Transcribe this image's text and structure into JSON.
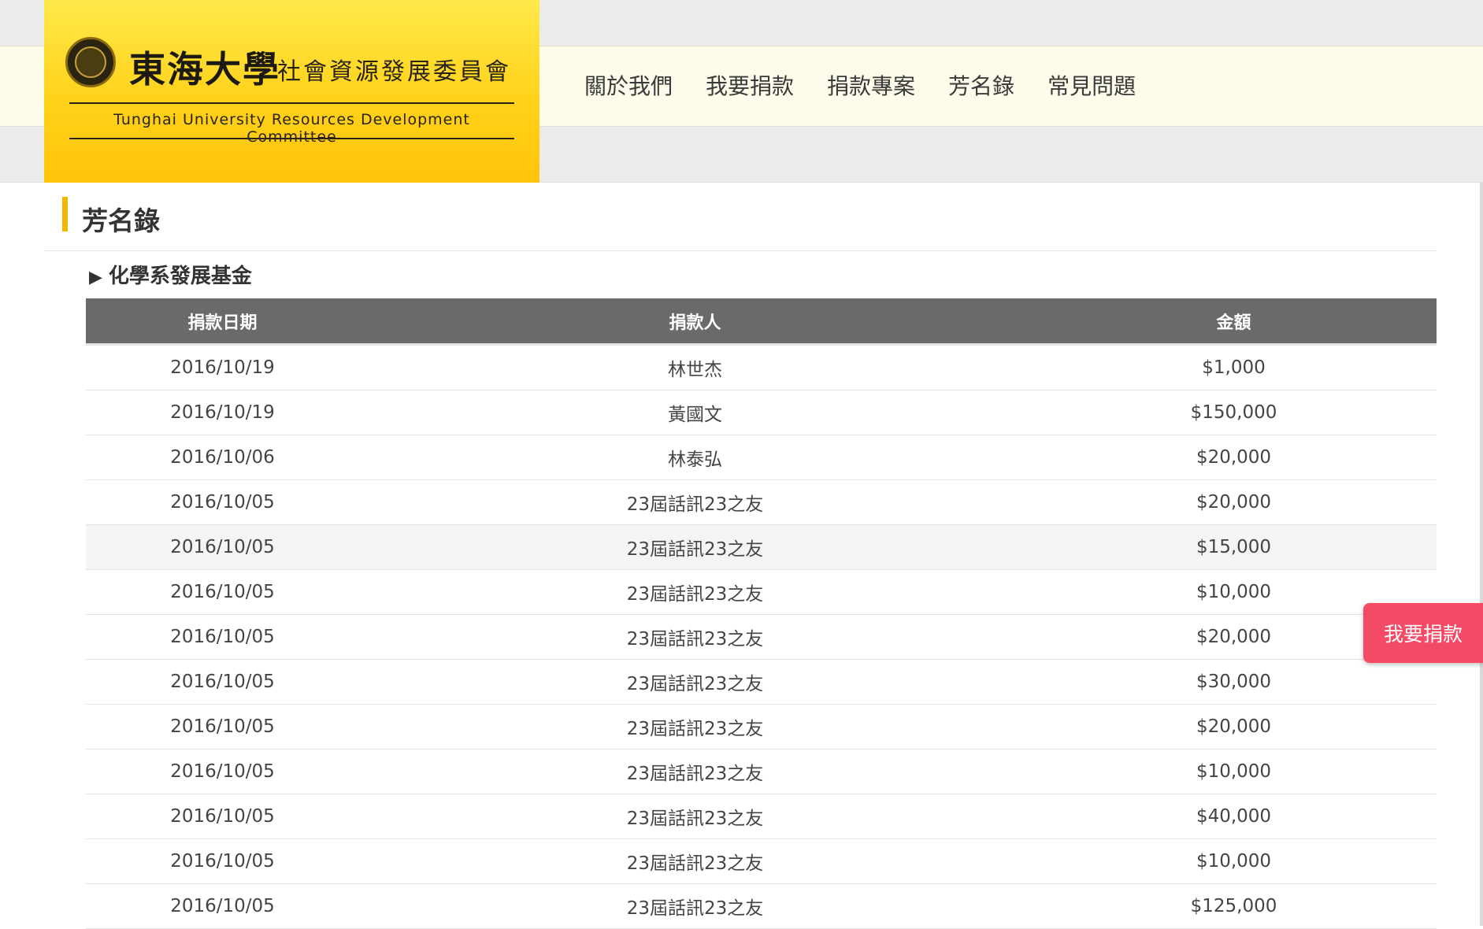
{
  "header": {
    "logo_cn": "東海大學",
    "logo_cn_sub": "社會資源發展委員會",
    "logo_en": "Tunghai University Resources Development Committee"
  },
  "nav": {
    "items": [
      {
        "label": "關於我們"
      },
      {
        "label": "我要捐款"
      },
      {
        "label": "捐款專案"
      },
      {
        "label": "芳名錄"
      },
      {
        "label": "常見問題"
      }
    ]
  },
  "page": {
    "title": "芳名錄",
    "fund_heading": "化學系發展基金",
    "fund_marker": "▶"
  },
  "table": {
    "columns": [
      "捐款日期",
      "捐款人",
      "金額"
    ],
    "rows": [
      {
        "date": "2016/10/19",
        "donor": "林世杰",
        "amount": "$1,000"
      },
      {
        "date": "2016/10/19",
        "donor": "黃國文",
        "amount": "$150,000"
      },
      {
        "date": "2016/10/06",
        "donor": "林泰弘",
        "amount": "$20,000"
      },
      {
        "date": "2016/10/05",
        "donor": "23屆話訊23之友",
        "amount": "$20,000"
      },
      {
        "date": "2016/10/05",
        "donor": "23屆話訊23之友",
        "amount": "$15,000"
      },
      {
        "date": "2016/10/05",
        "donor": "23屆話訊23之友",
        "amount": "$10,000"
      },
      {
        "date": "2016/10/05",
        "donor": "23屆話訊23之友",
        "amount": "$20,000"
      },
      {
        "date": "2016/10/05",
        "donor": "23屆話訊23之友",
        "amount": "$30,000"
      },
      {
        "date": "2016/10/05",
        "donor": "23屆話訊23之友",
        "amount": "$20,000"
      },
      {
        "date": "2016/10/05",
        "donor": "23屆話訊23之友",
        "amount": "$10,000"
      },
      {
        "date": "2016/10/05",
        "donor": "23屆話訊23之友",
        "amount": "$40,000"
      },
      {
        "date": "2016/10/05",
        "donor": "23屆話訊23之友",
        "amount": "$10,000"
      },
      {
        "date": "2016/10/05",
        "donor": "23屆話訊23之友",
        "amount": "$125,000"
      }
    ]
  },
  "floating": {
    "donate_label": "我要捐款"
  },
  "colors": {
    "accent": "#f2b600",
    "logo_yellow": "#ffd21a",
    "donate_button": "#f34b66",
    "table_header": "#6a6a6a"
  }
}
